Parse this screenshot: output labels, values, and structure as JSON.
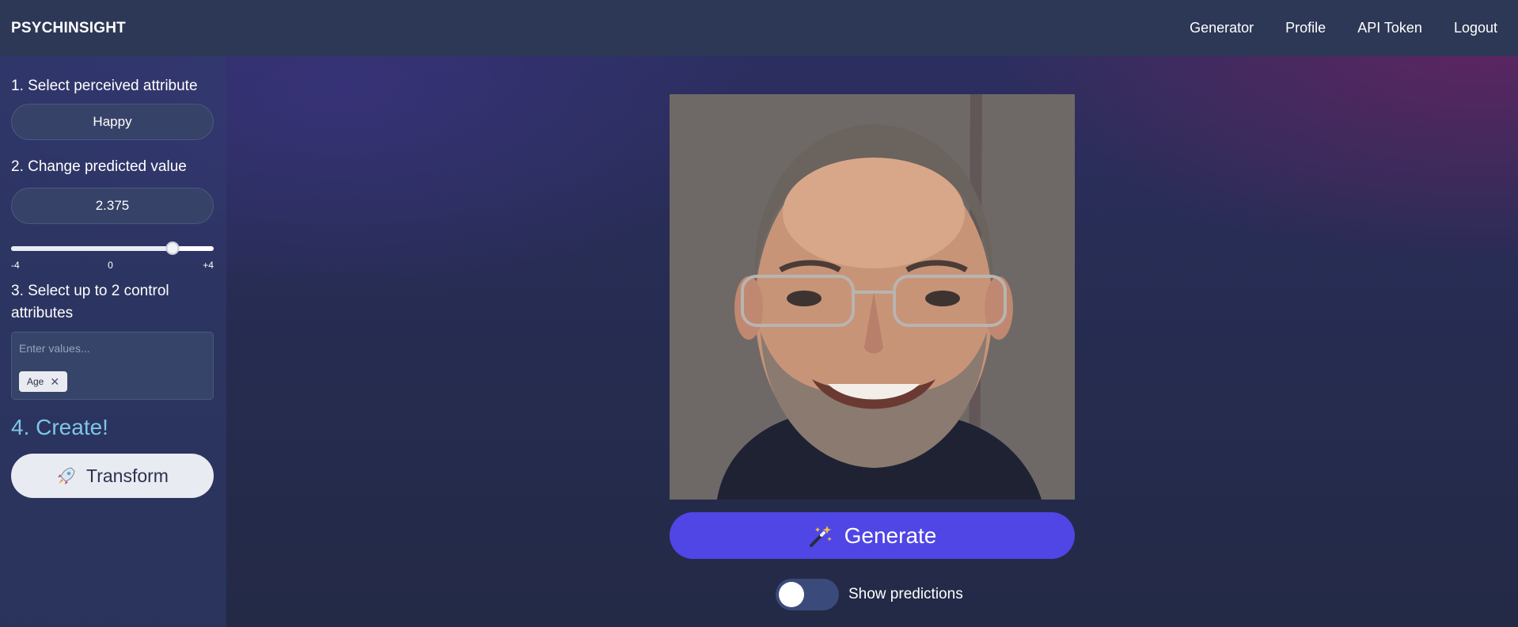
{
  "navbar": {
    "brand": "PSYCHINSIGHT",
    "links": [
      "Generator",
      "Profile",
      "API Token",
      "Logout"
    ]
  },
  "sidebar": {
    "step1_label": "1. Select perceived attribute",
    "attribute_value": "Happy",
    "step2_label": "2. Change predicted value",
    "predicted_value": "2.375",
    "slider": {
      "min_label": "-4",
      "mid_label": "0",
      "max_label": "+4",
      "min": -4,
      "max": 4,
      "value": 2.375
    },
    "step3_label": "3. Select up to 2 control attributes",
    "control_placeholder": "Enter values...",
    "control_tags": [
      "Age"
    ],
    "step4_label": "4. Create!",
    "transform_label": "Transform",
    "transform_icon": "rocket-icon"
  },
  "main": {
    "image_alt": "generated face",
    "generate_label": "Generate",
    "generate_icon": "magic-wand-icon",
    "show_predictions_label": "Show predictions",
    "show_predictions_on": false
  },
  "colors": {
    "accent": "#4f46e5",
    "create_label": "#7fc4ea",
    "navbar": "#2d3856"
  }
}
